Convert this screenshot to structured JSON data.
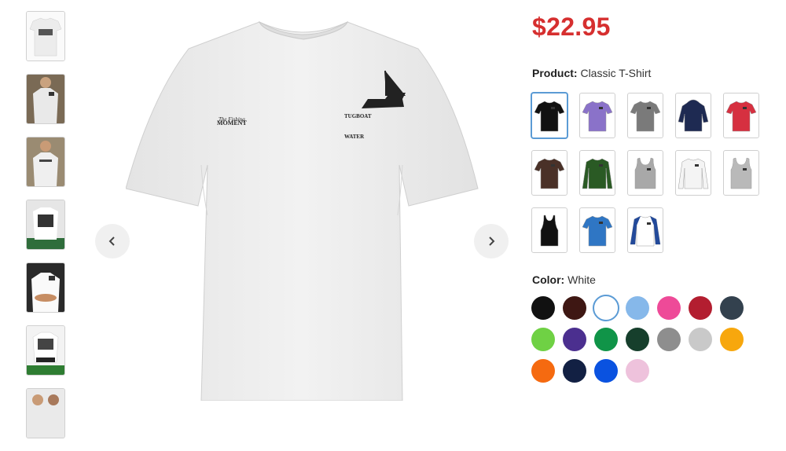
{
  "price": "$22.95",
  "product": {
    "label": "Product:",
    "value": "Classic T-Shirt"
  },
  "color": {
    "label": "Color:",
    "value": "White"
  },
  "shirt_print": {
    "left_chest_line1": "The Fishing",
    "left_chest_line2": "MOMENT",
    "right_line1": "TUGBOAT",
    "right_line2": "WATER"
  },
  "products": [
    {
      "name": "Classic T-Shirt",
      "color": "#111111",
      "style": "tee"
    },
    {
      "name": "Women T-Shirt",
      "color": "#8a72c9",
      "style": "tee"
    },
    {
      "name": "Tee Gray",
      "color": "#7a7a7a",
      "style": "tee"
    },
    {
      "name": "Hoodie",
      "color": "#1e2a52",
      "style": "hoodie"
    },
    {
      "name": "V-Neck Red",
      "color": "#d63040",
      "style": "tee"
    },
    {
      "name": "Brown Tee",
      "color": "#4a3128",
      "style": "tee"
    },
    {
      "name": "Long Sleeve",
      "color": "#2a5a24",
      "style": "long"
    },
    {
      "name": "Sleeveless Gray",
      "color": "#a8a8a8",
      "style": "tank"
    },
    {
      "name": "Long Sleeve White",
      "color": "#f4f4f4",
      "style": "long"
    },
    {
      "name": "Tank Gray",
      "color": "#b9b9b9",
      "style": "tank"
    },
    {
      "name": "Racerback Tank",
      "color": "#111111",
      "style": "racer"
    },
    {
      "name": "Blue Tee",
      "color": "#2f76c4",
      "style": "tee"
    },
    {
      "name": "Raglan",
      "color": "#ffffff",
      "style": "raglan"
    }
  ],
  "swatches": [
    {
      "name": "Black",
      "hex": "#111111"
    },
    {
      "name": "Maroon",
      "hex": "#3e1713"
    },
    {
      "name": "White",
      "hex": "#ffffff"
    },
    {
      "name": "Light Blue",
      "hex": "#86b8ea"
    },
    {
      "name": "Pink",
      "hex": "#ee4a98"
    },
    {
      "name": "Red",
      "hex": "#b31e30"
    },
    {
      "name": "Dark Gray",
      "hex": "#33414e"
    },
    {
      "name": "Lime",
      "hex": "#6fd144"
    },
    {
      "name": "Purple",
      "hex": "#4b2f8f"
    },
    {
      "name": "Green",
      "hex": "#109448"
    },
    {
      "name": "Forest",
      "hex": "#163f2c"
    },
    {
      "name": "Gray",
      "hex": "#8e8e8e"
    },
    {
      "name": "Ash",
      "hex": "#c9c9c9"
    },
    {
      "name": "Gold",
      "hex": "#f7a70d"
    },
    {
      "name": "Orange",
      "hex": "#f56a10"
    },
    {
      "name": "Navy",
      "hex": "#122043"
    },
    {
      "name": "Royal",
      "hex": "#0a52e0"
    },
    {
      "name": "Light Pink",
      "hex": "#eec2dc"
    }
  ],
  "selected_product_index": 0,
  "selected_swatch_index": 2
}
